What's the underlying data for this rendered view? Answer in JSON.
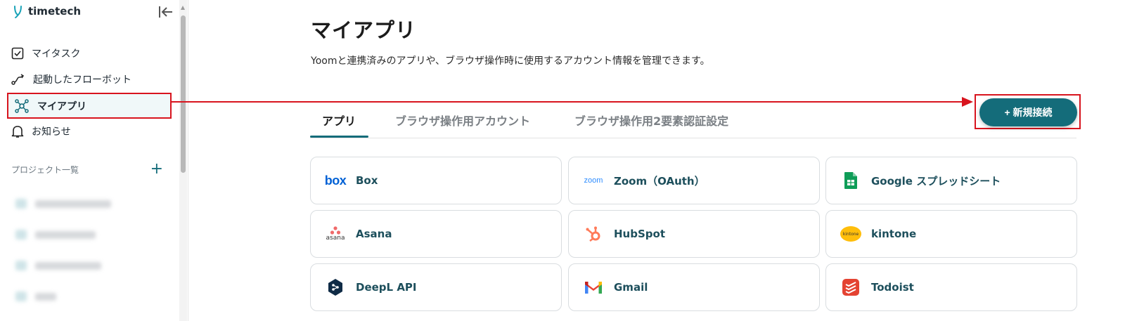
{
  "sidebar": {
    "brand": "timetech",
    "items": [
      {
        "label": "マイタスク"
      },
      {
        "label": "起動したフローボット"
      },
      {
        "label": "マイアプリ"
      },
      {
        "label": "お知らせ"
      }
    ],
    "projects_title": "プロジェクト一覧",
    "projects_add": "+"
  },
  "main": {
    "title": "マイアプリ",
    "description": "Yoomと連携済みのアプリや、ブラウザ操作時に使用するアカウント情報を管理できます。",
    "tabs": [
      {
        "label": "アプリ",
        "active": true
      },
      {
        "label": "ブラウザ操作用アカウント",
        "active": false
      },
      {
        "label": "ブラウザ操作用2要素認証設定",
        "active": false
      }
    ],
    "new_connection_button": "+ 新規接続",
    "apps": [
      {
        "name": "Box",
        "logo_text": "box",
        "icon": "box-logo-icon"
      },
      {
        "name": "Zoom（OAuth）",
        "logo_text": "zoom",
        "icon": "zoom-logo-icon"
      },
      {
        "name": "Google スプレッドシート",
        "icon": "google-sheets-icon"
      },
      {
        "name": "Asana",
        "logo_text": "asana",
        "icon": "asana-logo-icon"
      },
      {
        "name": "HubSpot",
        "icon": "hubspot-icon"
      },
      {
        "name": "kintone",
        "logo_text": "kintone",
        "icon": "kintone-icon"
      },
      {
        "name": "DeepL API",
        "icon": "deepl-icon"
      },
      {
        "name": "Gmail",
        "icon": "gmail-icon"
      },
      {
        "name": "Todoist",
        "icon": "todoist-icon"
      }
    ]
  },
  "colors": {
    "accent": "#146c7a",
    "highlight": "#d8141e",
    "active_bg": "#f0f8f9"
  }
}
